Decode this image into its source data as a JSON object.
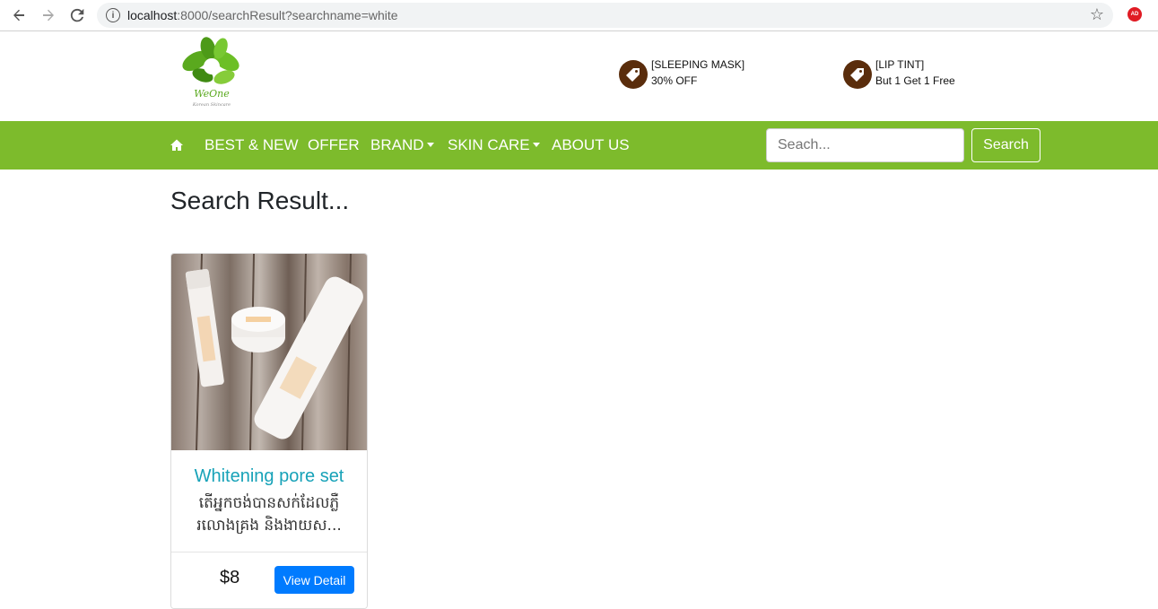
{
  "browser": {
    "url_host": "localhost",
    "url_rest": ":8000/searchResult?searchname=white",
    "ext_label": "AD"
  },
  "brand": {
    "logo_text": "WeOne",
    "logo_sub": "Korean Skincare"
  },
  "promos": [
    {
      "line1": "[SLEEPING MASK]",
      "line2": "30% OFF",
      "icon": "price-tag-icon"
    },
    {
      "line1": "[LIP TINT]",
      "line2": "But 1 Get 1 Free",
      "icon": "price-tag-icon"
    }
  ],
  "nav": {
    "home_icon": "home-icon",
    "items": [
      {
        "label": "BEST & NEW"
      },
      {
        "label": "OFFER"
      },
      {
        "label": "BRAND"
      },
      {
        "label": "SKIN CARE"
      },
      {
        "label": "ABOUT US"
      }
    ],
    "search_placeholder": "Seach...",
    "search_button": "Search"
  },
  "colors": {
    "nav_bg": "#7dbb2c",
    "tag_circle": "#5a2d0c",
    "title_link": "#17a2b8",
    "primary_button": "#007bff"
  },
  "main": {
    "title": "Search Result...",
    "products": [
      {
        "name": "Whitening pore set",
        "description": "តើអ្នកចង់បានសក់ដែលភ្លឺរលោងគ្រង និងងាយស...",
        "price": "$8",
        "button": "View Detail"
      }
    ]
  }
}
